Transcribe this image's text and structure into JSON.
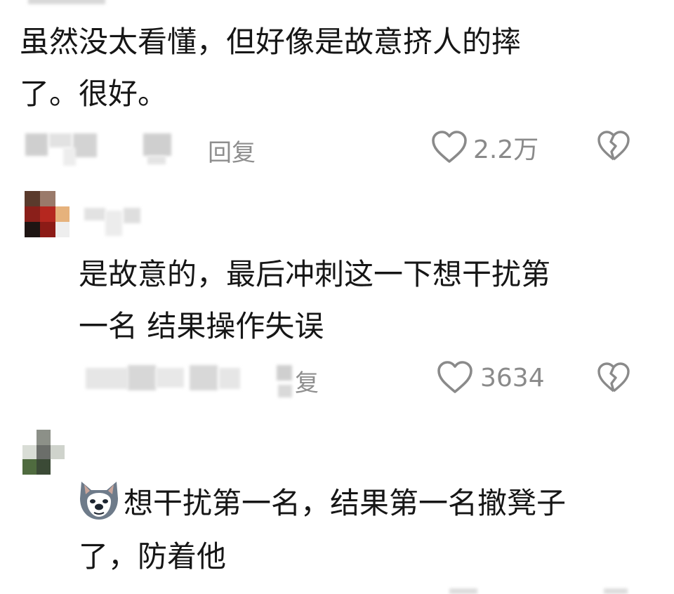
{
  "comments": [
    {
      "lines": [
        "虽然没太看懂，但好像是故意挤人的摔",
        "了。很好。"
      ],
      "reply_label": "回复",
      "likes": "2.2万"
    },
    {
      "lines": [
        "是故意的，最后冲刺这一下想干扰第",
        "一名 结果操作失误"
      ],
      "reply_label": "复",
      "likes": "3634"
    },
    {
      "lines": [
        "想干扰第一名，结果第一名撤凳子",
        "了，防着他"
      ],
      "emoji": "wolf-face-emoji"
    }
  ],
  "icons": {
    "like": "heart-outline-icon",
    "dislike": "broken-heart-icon"
  },
  "colors": {
    "text": "#161616",
    "meta": "#8e8e8e",
    "icon": "#8a8a8a"
  }
}
